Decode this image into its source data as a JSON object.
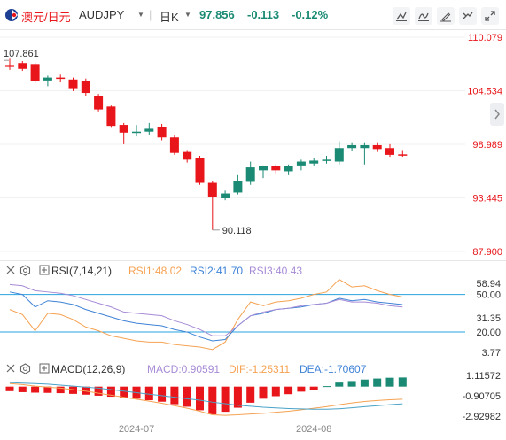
{
  "header": {
    "pair_cn": "澳元/日元",
    "symbol": "AUDJPY",
    "period": "日K",
    "last": "97.856",
    "change": "-0.113",
    "change_pct": "-0.12%"
  },
  "colors": {
    "up": "#1a8a74",
    "down": "#e8151a",
    "rsi1": "#f5a252",
    "rsi2": "#3f83d6",
    "rsi3": "#a78bd6",
    "macd_dif": "#f5a252",
    "macd_dea": "#4aa3c8",
    "axis_text": "#e8151a",
    "level_line": "#27a3e0"
  },
  "price_axis_labels": [
    "110.079",
    "104.534",
    "98.989",
    "93.445",
    "87.900"
  ],
  "annotations": {
    "high_label": "107.861",
    "low_label": "90.118"
  },
  "rsi": {
    "title": "RSI(7,14,21)",
    "rsi1_label": "RSI1:48.02",
    "rsi2_label": "RSI2:41.70",
    "rsi3_label": "RSI3:40.43",
    "axis_labels": [
      "58.94",
      "50.00",
      "31.35",
      "20.00",
      "3.77"
    ]
  },
  "macd": {
    "title": "MACD(12,26,9)",
    "macd_label": "MACD:0.90591",
    "dif_label": "DIF:-1.25311",
    "dea_label": "DEA:-1.70607",
    "axis_labels": [
      "1.11572",
      "-0.90705",
      "-2.92982"
    ]
  },
  "x_axis_labels": [
    "2024-07",
    "2024-08"
  ],
  "chart_data": [
    {
      "type": "candlestick",
      "title": "AUDJPY 日K",
      "ylim": [
        87.9,
        110.079
      ],
      "candles": [
        {
          "o": 107.2,
          "h": 107.861,
          "l": 106.7,
          "c": 107.0
        },
        {
          "o": 107.4,
          "h": 107.6,
          "l": 106.6,
          "c": 106.8
        },
        {
          "o": 107.3,
          "h": 107.5,
          "l": 105.3,
          "c": 105.5
        },
        {
          "o": 105.6,
          "h": 106.1,
          "l": 105.0,
          "c": 105.9
        },
        {
          "o": 105.9,
          "h": 106.2,
          "l": 105.4,
          "c": 105.8
        },
        {
          "o": 105.7,
          "h": 105.9,
          "l": 104.5,
          "c": 104.8
        },
        {
          "o": 105.5,
          "h": 105.8,
          "l": 104.0,
          "c": 104.3
        },
        {
          "o": 104.0,
          "h": 104.2,
          "l": 102.4,
          "c": 102.6
        },
        {
          "o": 102.9,
          "h": 103.0,
          "l": 100.7,
          "c": 100.9
        },
        {
          "o": 101.0,
          "h": 101.2,
          "l": 99.0,
          "c": 100.2
        },
        {
          "o": 100.2,
          "h": 101.0,
          "l": 99.8,
          "c": 100.3
        },
        {
          "o": 100.3,
          "h": 101.2,
          "l": 100.0,
          "c": 100.6
        },
        {
          "o": 100.8,
          "h": 101.1,
          "l": 99.4,
          "c": 99.7
        },
        {
          "o": 99.7,
          "h": 99.9,
          "l": 97.9,
          "c": 98.1
        },
        {
          "o": 98.2,
          "h": 98.4,
          "l": 97.1,
          "c": 97.4
        },
        {
          "o": 97.6,
          "h": 97.8,
          "l": 94.8,
          "c": 95.0
        },
        {
          "o": 95.0,
          "h": 95.2,
          "l": 90.118,
          "c": 93.5
        },
        {
          "o": 93.4,
          "h": 94.2,
          "l": 93.2,
          "c": 93.9
        },
        {
          "o": 94.0,
          "h": 95.8,
          "l": 93.8,
          "c": 95.2
        },
        {
          "o": 95.1,
          "h": 97.2,
          "l": 94.8,
          "c": 96.6
        },
        {
          "o": 96.3,
          "h": 96.8,
          "l": 95.5,
          "c": 96.7
        },
        {
          "o": 96.7,
          "h": 96.9,
          "l": 96.0,
          "c": 96.3
        },
        {
          "o": 96.2,
          "h": 96.9,
          "l": 95.8,
          "c": 96.7
        },
        {
          "o": 96.8,
          "h": 97.4,
          "l": 96.3,
          "c": 97.2
        },
        {
          "o": 97.0,
          "h": 97.6,
          "l": 96.8,
          "c": 97.3
        },
        {
          "o": 97.3,
          "h": 97.8,
          "l": 97.0,
          "c": 97.4
        },
        {
          "o": 97.2,
          "h": 99.3,
          "l": 96.9,
          "c": 98.6
        },
        {
          "o": 98.6,
          "h": 99.2,
          "l": 98.3,
          "c": 98.9
        },
        {
          "o": 98.6,
          "h": 99.2,
          "l": 96.9,
          "c": 98.9
        },
        {
          "o": 98.9,
          "h": 99.2,
          "l": 98.2,
          "c": 98.5
        },
        {
          "o": 98.6,
          "h": 99.0,
          "l": 97.7,
          "c": 97.9
        },
        {
          "o": 97.95,
          "h": 98.4,
          "l": 97.7,
          "c": 97.85
        }
      ]
    },
    {
      "type": "line",
      "title": "RSI(7,14,21)",
      "ylim": [
        3.77,
        58.94
      ],
      "series": [
        {
          "name": "RSI1",
          "values": [
            38,
            34,
            21,
            35,
            34,
            30,
            24,
            21,
            17,
            15,
            13,
            12,
            12,
            10,
            9,
            8,
            6,
            12,
            30,
            44,
            41,
            44,
            45,
            47,
            50,
            52,
            62,
            56,
            57,
            53,
            50,
            48
          ]
        },
        {
          "name": "RSI2",
          "values": [
            52,
            50,
            40,
            45,
            44,
            42,
            38,
            35,
            32,
            29,
            27,
            26,
            25,
            22,
            20,
            16,
            13,
            14,
            25,
            33,
            35,
            38,
            39,
            40,
            42,
            43,
            47,
            45,
            46,
            44,
            43,
            42
          ]
        },
        {
          "name": "RSI3",
          "values": [
            58,
            57,
            53,
            52,
            51,
            49,
            46,
            43,
            40,
            36,
            35,
            34,
            33,
            29,
            26,
            22,
            17,
            17,
            25,
            33,
            36,
            38,
            39,
            41,
            42,
            43,
            46,
            44,
            44,
            43,
            41,
            40
          ]
        }
      ]
    },
    {
      "type": "bar+line",
      "title": "MACD(12,26,9)",
      "ylim": [
        -2.92982,
        1.11572
      ],
      "series": [
        {
          "name": "MACD",
          "values": [
            -0.45,
            -0.55,
            -0.6,
            -0.62,
            -0.65,
            -0.72,
            -0.8,
            -0.9,
            -1.0,
            -1.1,
            -1.2,
            -1.35,
            -1.5,
            -1.75,
            -2.0,
            -2.35,
            -2.75,
            -2.5,
            -2.1,
            -1.6,
            -1.2,
            -0.95,
            -0.75,
            -0.5,
            -0.3,
            0.05,
            0.4,
            0.55,
            0.7,
            0.8,
            0.88,
            0.90591
          ]
        },
        {
          "name": "DIF",
          "values": [
            0.3,
            0.2,
            0.05,
            -0.05,
            -0.15,
            -0.3,
            -0.45,
            -0.65,
            -0.85,
            -1.05,
            -1.25,
            -1.45,
            -1.65,
            -1.9,
            -2.15,
            -2.45,
            -2.8,
            -2.85,
            -2.8,
            -2.72,
            -2.65,
            -2.55,
            -2.45,
            -2.3,
            -2.15,
            -2.0,
            -1.8,
            -1.62,
            -1.48,
            -1.38,
            -1.3,
            -1.25311
          ]
        },
        {
          "name": "DEA",
          "values": [
            0.4,
            0.35,
            0.3,
            0.25,
            0.15,
            0.05,
            -0.05,
            -0.15,
            -0.3,
            -0.45,
            -0.6,
            -0.75,
            -0.9,
            -1.05,
            -1.2,
            -1.35,
            -1.55,
            -1.7,
            -1.85,
            -1.95,
            -2.05,
            -2.12,
            -2.18,
            -2.22,
            -2.25,
            -2.25,
            -2.2,
            -2.1,
            -2.0,
            -1.9,
            -1.8,
            -1.70607
          ]
        }
      ]
    }
  ]
}
